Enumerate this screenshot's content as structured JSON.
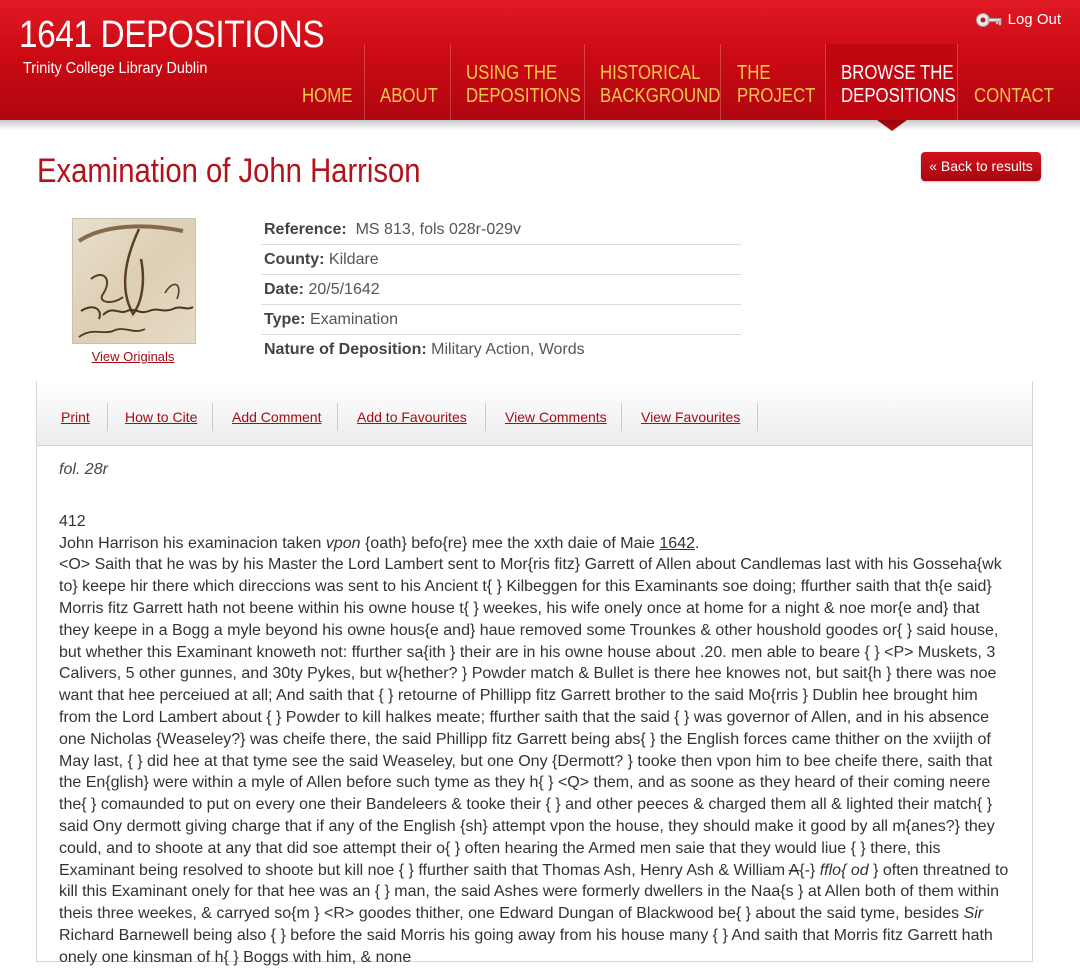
{
  "site": {
    "title": "1641 DEPOSITIONS",
    "subtitle": "Trinity College Library Dublin",
    "logout": "Log Out"
  },
  "nav": [
    {
      "label": "HOME"
    },
    {
      "label": "ABOUT"
    },
    {
      "label": "USING THE DEPOSITIONS"
    },
    {
      "label": "HISTORICAL BACKGROUND"
    },
    {
      "label": "THE PROJECT"
    },
    {
      "label": "BROWSE THE DEPOSITIONS",
      "active": true
    },
    {
      "label": "CONTACT"
    }
  ],
  "page": {
    "title": "Examination of John Harrison",
    "back_label": "« Back to results",
    "view_originals": "View Originals"
  },
  "meta": {
    "reference_label": "Reference:",
    "reference": "MS 813, fols 028r-029v",
    "county_label": "County:",
    "county": "Kildare",
    "date_label": "Date:",
    "date": "20/5/1642",
    "type_label": "Type:",
    "type": "Examination",
    "nature_label": "Nature of Deposition:",
    "nature": "Military Action, Words"
  },
  "toolbar": {
    "print": "Print",
    "cite": "How to Cite",
    "add_comment": "Add Comment",
    "add_fav": "Add to Favourites",
    "view_comments": "View Comments",
    "view_fav": "View Favourites"
  },
  "transcript": {
    "folio": "fol. 28r",
    "page_no": "412",
    "line1_a": "John Harrison his examinacion taken ",
    "line1_vpon": "vpon",
    "line1_b": " {oath} befo{re} mee the xxth daie of Maie ",
    "line1_year": "1642",
    "line1_end": ".",
    "para_a": "<O> Saith that he was by his Master the Lord Lambert sent to Mor{ris fitz} Garrett of Allen about Candlemas last with his Gosseha{wk to} keepe hir there which direccions was sent to his Ancient t{ } Kilbeggen for this Examinants soe doing; ffurther saith that th{e said} Morris fitz Garrett hath not beene within his owne house t{ } weekes, his wife onely once at home for a night & noe mor{e and} that they keepe in a Bogg a myle beyond his owne hous{e and} haue removed some Trounkes & other houshold goodes or{ } said house, but whether this Examinant knoweth not: ffurther sa{ith } their are in his owne house about .20. men able to beare { } <P> Muskets, 3 Calivers, 5 other gunnes, and 30ty Pykes, but w{hether? } Powder match & Bullet is there hee knowes not, but sait{h } there was noe want that hee perceiued at all; And saith that { } retourne of Phillipp fitz Garrett brother to the said Mo{rris } Dublin hee brought him from the Lord Lambert about { } Powder to kill halkes meate; ffurther saith that the said { } was governor of Allen, and in his absence one Nicholas {Weaseley?} was cheife there, the said Phillipp fitz Garrett being abs{ } the English forces came thither on the xviijth of May last, { } did hee at that tyme see the said Weaseley, but one Ony {Dermott? } tooke then vpon him to bee cheife there, saith that the En{glish} were within a myle of Allen before such tyme as they h{ } <Q> them, and as soone as they heard of their coming neere the{ } comaunded to put on every one their Bandeleers & tooke their { } and other peeces & charged them all & lighted their match{ } said Ony dermott giving charge that if any of the English {sh} attempt vpon the house, they should make it good by all m{anes?} they could, and to shoote at any that did soe attempt their o{ } often hearing the Armed men saie that they would liue { } there, this Examinant being resolved to shoote but kill noe { } ffurther saith that Thomas Ash, Henry Ash & William ",
    "para_strike": "A",
    "para_b": "{-} ",
    "para_fflo": "fflo{ od",
    "para_c": " } often threatned to kill this Examinant onely for that hee was an { } man, the said Ashes were formerly dwellers in the Naa{s } at Allen both of them within theis three weekes, & carryed so{m } <R> goodes thither, one Edward Dungan of Blackwood be{ } about the said tyme, besides ",
    "para_sir": "Sir",
    "para_d": " Richard Barnewell being also { } before the said Morris his going away from his house many { } And saith that Morris fitz Garrett hath onely one kinsman of h{ } Boggs with him, & none"
  }
}
